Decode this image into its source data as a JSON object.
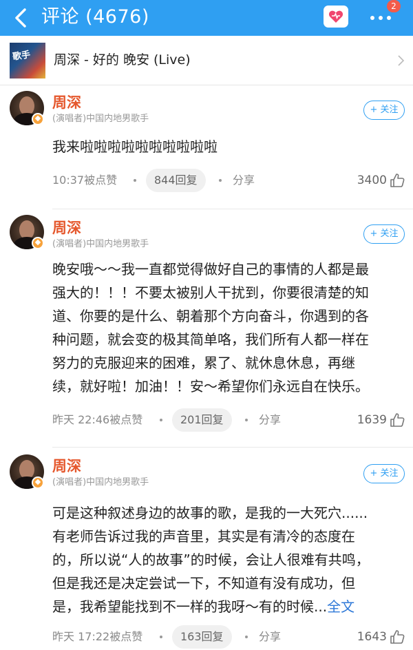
{
  "header": {
    "title": "评论 (4676)",
    "notification_count": "2",
    "back_icon": "chevron-left-icon",
    "favorite_icon": "heart-icon",
    "more_icon": "more-dots-icon"
  },
  "song": {
    "title": "周深 - 好的 晚安 (Live)",
    "thumb_text": "歌手"
  },
  "comments": [
    {
      "user": "周深",
      "tag": "(演唱者)中国内地男歌手",
      "follow": "+ 关注",
      "text": "我来啦啦啦啦啦啦啦啦啦啦",
      "time": "10:37被点赞",
      "replies": "844回复",
      "share": "分享",
      "likes": "3400"
    },
    {
      "user": "周深",
      "tag": "(演唱者)中国内地男歌手",
      "follow": "+ 关注",
      "lines": [
        "晚安哦～～我一直都觉得做好自己的事情的人都是最",
        "强大的！！！不要太被别人干扰到，你要很清楚的知",
        "道、你要的是什么、朝着那个方向奋斗，你遇到的各",
        "种问题，就会变的极其简单咯，我们所有人都一样在",
        "努力的克服迎来的困难，累了、就休息休息，再继",
        "续，就好啦！加油！！安～希望你们永远自在快乐。"
      ],
      "time": "昨天 22:46被点赞",
      "replies": "201回复",
      "share": "分享",
      "likes": "1639"
    },
    {
      "user": "周深",
      "tag": "(演唱者)中国内地男歌手",
      "follow": "+ 关注",
      "lines": [
        "可是这种叙述身边的故事的歌，是我的一大死穴......",
        "有老师告诉过我的声音里，其实是有清冷的态度在",
        "的，所以说“人的故事”的时候，会让人很难有共鸣，",
        "但是我还是决定尝试一下，不知道有没有成功，但",
        "是，我希望能找到不一样的我呀～有的时候..."
      ],
      "more": "全文",
      "time": "昨天 17:22被点赞",
      "replies": "163回复",
      "share": "分享",
      "likes": "1643"
    }
  ],
  "colors": {
    "header_bg": "#2f9ff2",
    "username": "#e5582d",
    "link": "#2f79d8"
  }
}
